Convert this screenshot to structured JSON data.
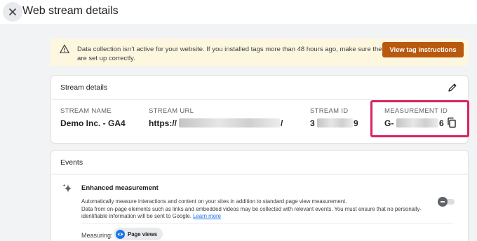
{
  "header": {
    "title": "Web stream details"
  },
  "banner": {
    "message": "Data collection isn’t active for your website. If you installed tags more than 48 hours ago, make sure they are set up correctly.",
    "button_label": "View tag instructions"
  },
  "stream_details": {
    "title": "Stream details",
    "fields": {
      "stream_name": {
        "label": "STREAM NAME",
        "value": "Demo Inc. - GA4"
      },
      "stream_url": {
        "label": "STREAM URL",
        "prefix": "https://",
        "suffix": "/"
      },
      "stream_id": {
        "label": "STREAM ID",
        "prefix": "3",
        "suffix": "9"
      },
      "measurement_id": {
        "label": "MEASUREMENT ID",
        "prefix": "G-",
        "suffix": "6"
      }
    }
  },
  "events": {
    "title": "Events",
    "enhanced_measurement": {
      "title": "Enhanced measurement",
      "description_line1": "Automatically measure interactions and content on your sites in addition to standard page view measurement.",
      "description_line2": "Data from on-page elements such as links and embedded videos may be collected with relevant events. You must ensure that no personally-identifiable information will be sent to Google.",
      "learn_more": "Learn more",
      "toggle_on": false
    },
    "measuring_label": "Measuring:",
    "measuring_chip": "Page views"
  },
  "colors": {
    "highlight_border": "#d8245c",
    "banner_button": "#b9590e",
    "banner_background": "#fef7e0",
    "link": "#1a73e8"
  },
  "icons": {
    "close": "close-icon",
    "warning": "warning-icon",
    "edit": "pencil-icon",
    "copy": "copy-icon",
    "sparkle": "sparkle-icon",
    "eye": "eye-icon"
  }
}
